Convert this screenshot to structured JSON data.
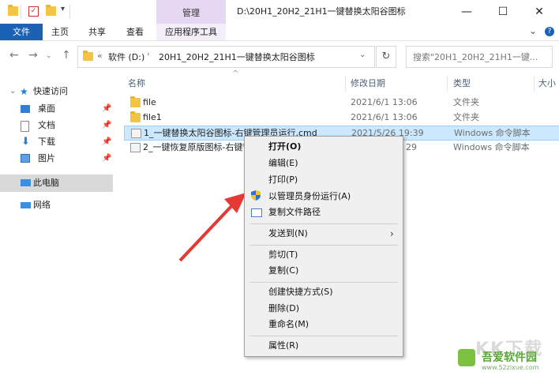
{
  "window": {
    "title": "D:\\20H1_20H2_21H1一键替换太阳谷图标",
    "context_tab": "管理",
    "minimize": "—",
    "maximize": "☐",
    "close": "✕"
  },
  "ribbon": {
    "tabs": [
      "文件",
      "主页",
      "共享",
      "查看",
      "应用程序工具"
    ],
    "expand": "⌄",
    "help": "?"
  },
  "address": {
    "breadcrumb_prefix": "«",
    "segments": [
      "软件 (D:)",
      "20H1_20H2_21H1一键替换太阳谷图标"
    ],
    "search_placeholder": "搜索\"20H1_20H2_21H1一键..."
  },
  "columns": [
    "名称",
    "修改日期",
    "类型",
    "大小"
  ],
  "nav": {
    "quick_access": "快速访问",
    "items": [
      "桌面",
      "文档",
      "下载",
      "图片"
    ],
    "this_pc": "此电脑",
    "network": "网络"
  },
  "files": [
    {
      "name": "file",
      "date": "2021/6/1 13:06",
      "type": "文件夹"
    },
    {
      "name": "file1",
      "date": "2021/6/1 13:06",
      "type": "文件夹"
    },
    {
      "name": "1_一键替换太阳谷图标-右键管理员运行.cmd",
      "date": "2021/5/26 19:39",
      "type": "Windows 命令脚本"
    },
    {
      "name": "2_一键恢复原版图标-右键管",
      "date": "29",
      "type": "Windows 命令脚本"
    }
  ],
  "context_menu": {
    "open": "打开(O)",
    "edit": "编辑(E)",
    "print": "打印(P)",
    "run_as_admin": "以管理员身份运行(A)",
    "copy_path": "复制文件路径",
    "send_to": "发送到(N)",
    "cut": "剪切(T)",
    "copy": "复制(C)",
    "create_shortcut": "创建快捷方式(S)",
    "delete": "删除(D)",
    "rename": "重命名(M)",
    "properties": "属性(R)"
  },
  "watermark": {
    "brand": "吾爱软件园",
    "url": "www.52zixue.com",
    "logo_text": "KK下载"
  },
  "colors": {
    "file_tab": "#1b62b5",
    "manage_tab": "#e6d7f2",
    "selection": "#cce8ff",
    "arrow": "#e53935",
    "folder": "#f4c542"
  }
}
